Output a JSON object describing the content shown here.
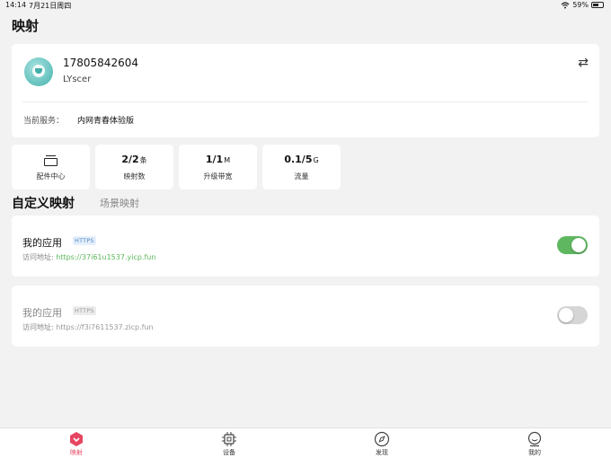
{
  "status_bar": {
    "time": "14:14",
    "date": "7月21日周四",
    "battery": "59%",
    "battery_level": 0.59
  },
  "page_title": "映射",
  "account": {
    "phone": "17805842604",
    "name": "LYscer",
    "service_label": "当前服务：",
    "service_value": "内网青春体验版",
    "switch_icon": "swap-icon"
  },
  "stats": [
    {
      "label": "配件中心",
      "icon": "accessory-box-icon"
    },
    {
      "value": "2/2",
      "unit": "条",
      "label": "映射数"
    },
    {
      "value": "1/1",
      "unit": "M",
      "label": "升级带宽"
    },
    {
      "value": "0.1/5",
      "unit": "G",
      "label": "流量"
    }
  ],
  "tabs": {
    "active": "自定义映射",
    "inactive": "场景映射"
  },
  "apps": [
    {
      "name": "我的应用",
      "badge": "HTTPS",
      "url_label": "访问地址:",
      "url": "https://37i61u1537.yicp.fun",
      "enabled": true
    },
    {
      "name": "我的应用",
      "badge": "HTTPS",
      "url_label": "访问地址:",
      "url": "https://f3i7611537.zicp.fun",
      "enabled": false
    }
  ],
  "nav": [
    {
      "label": "映射",
      "icon": "mapping-icon",
      "active": true
    },
    {
      "label": "设备",
      "icon": "device-chip-icon",
      "active": false
    },
    {
      "label": "发现",
      "icon": "compass-icon",
      "active": false
    },
    {
      "label": "我的",
      "icon": "profile-icon",
      "active": false
    }
  ],
  "colors": {
    "accent": "#e64560",
    "toggle_on": "#5fb760",
    "url_green": "#5cb85c",
    "badge_blue": "#4a86c8"
  }
}
